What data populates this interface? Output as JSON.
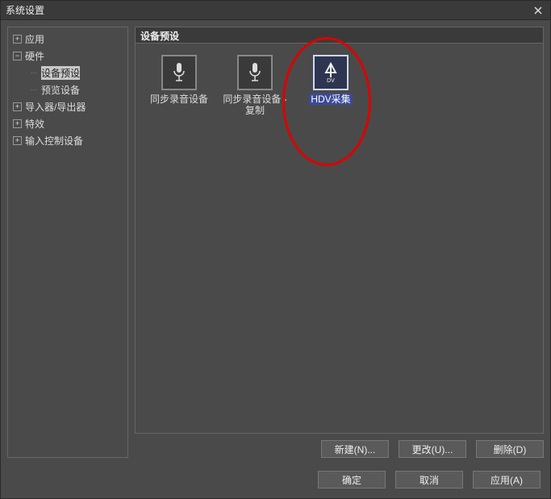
{
  "window": {
    "title": "系统设置"
  },
  "tree": {
    "items": [
      {
        "label": "应用",
        "expandable": true,
        "expanded": false
      },
      {
        "label": "硬件",
        "expandable": true,
        "expanded": true,
        "children": [
          {
            "label": "设备预设",
            "selected": true
          },
          {
            "label": "预览设备"
          }
        ]
      },
      {
        "label": "导入器/导出器",
        "expandable": true,
        "expanded": false
      },
      {
        "label": "特效",
        "expandable": true,
        "expanded": false
      },
      {
        "label": "输入控制设备",
        "expandable": true,
        "expanded": false
      }
    ]
  },
  "section": {
    "title": "设备预设"
  },
  "presets": [
    {
      "label": "同步录音设备",
      "icon": "mic"
    },
    {
      "label": "同步录音设备 - 复制",
      "icon": "mic"
    },
    {
      "label": "HDV采集",
      "icon": "dv",
      "selected": true
    }
  ],
  "actions": {
    "new": "新建(N)...",
    "change": "更改(U)...",
    "delete": "删除(D)"
  },
  "footer": {
    "ok": "确定",
    "cancel": "取消",
    "apply": "应用(A)"
  }
}
